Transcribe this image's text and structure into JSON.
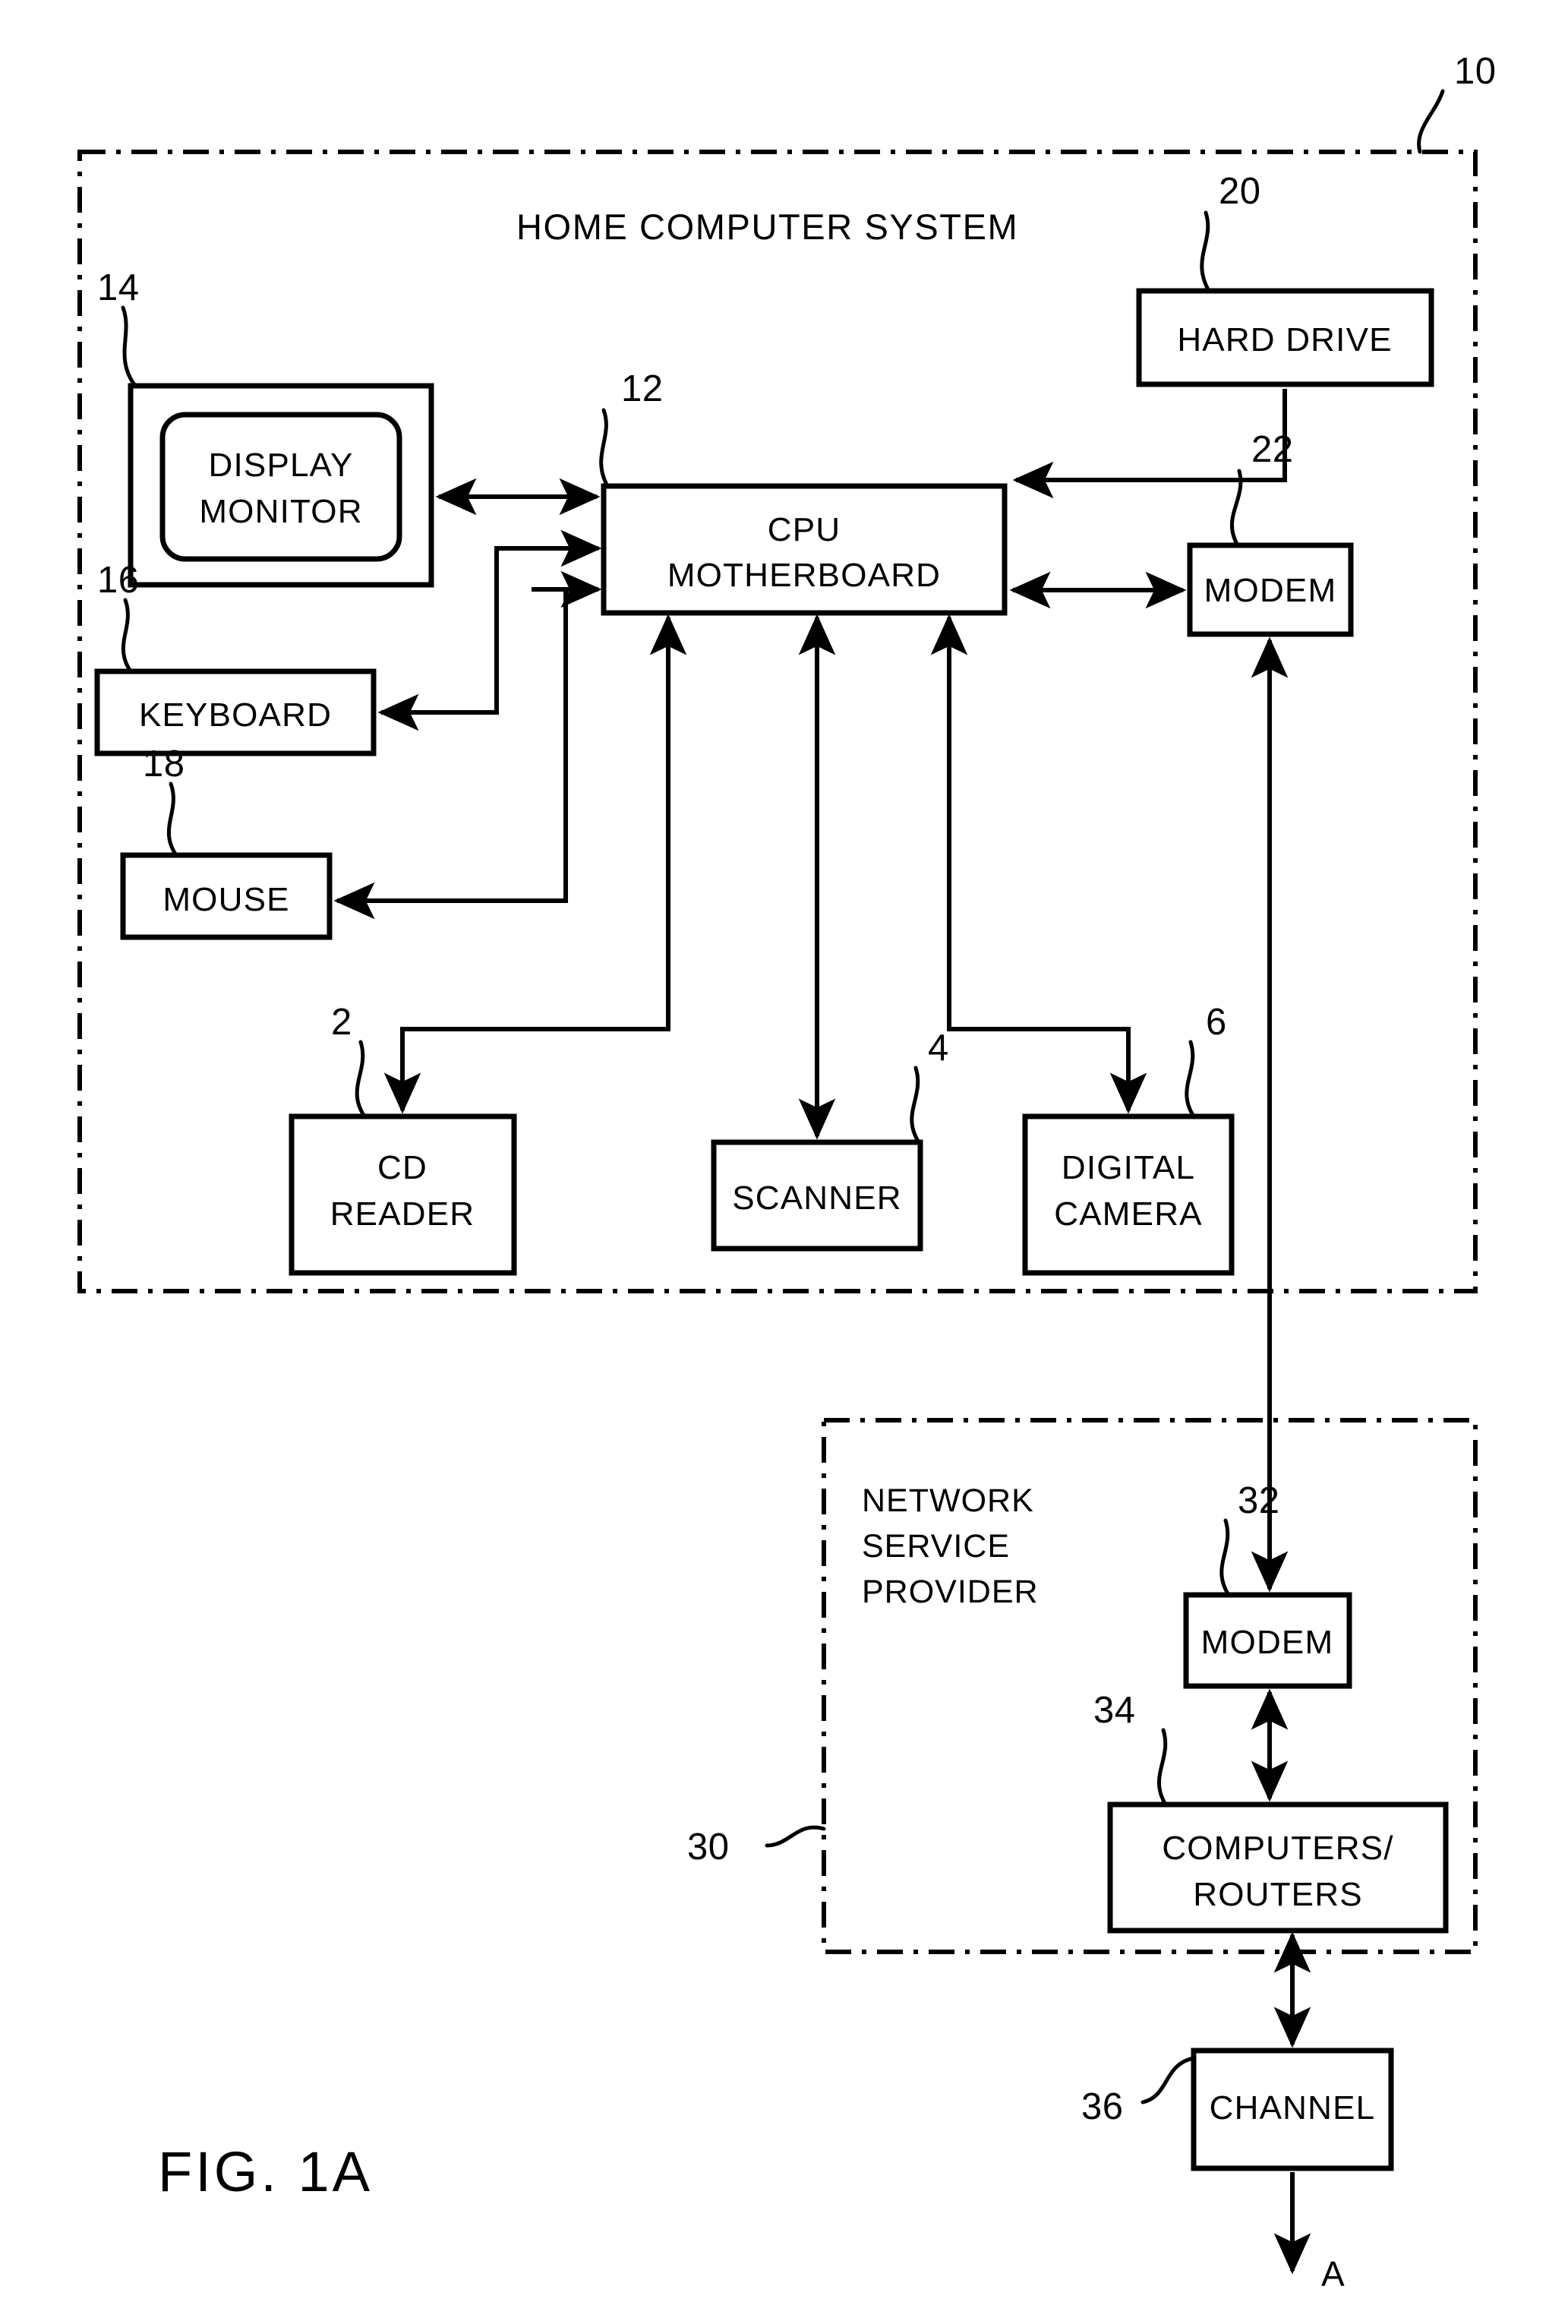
{
  "figure": {
    "caption": "FIG.  1A",
    "continuation_marker": "A"
  },
  "groups": [
    {
      "id": "home-computer-system",
      "title": "HOME COMPUTER SYSTEM",
      "ref": "10"
    },
    {
      "id": "network-service-provider",
      "title_lines": [
        "NETWORK",
        "SERVICE",
        "PROVIDER"
      ],
      "ref": "30"
    }
  ],
  "blocks": [
    {
      "id": "display-monitor",
      "ref": "14",
      "lines": [
        "DISPLAY",
        "MONITOR"
      ]
    },
    {
      "id": "cpu-motherboard",
      "ref": "12",
      "lines": [
        "CPU",
        "MOTHERBOARD"
      ]
    },
    {
      "id": "hard-drive",
      "ref": "20",
      "lines": [
        "HARD  DRIVE"
      ]
    },
    {
      "id": "modem-home",
      "ref": "22",
      "lines": [
        "MODEM"
      ]
    },
    {
      "id": "keyboard",
      "ref": "16",
      "lines": [
        "KEYBOARD"
      ]
    },
    {
      "id": "mouse",
      "ref": "18",
      "lines": [
        "MOUSE"
      ]
    },
    {
      "id": "cd-reader",
      "ref": "2",
      "lines": [
        "CD",
        "READER"
      ]
    },
    {
      "id": "scanner",
      "ref": "4",
      "lines": [
        "SCANNER"
      ]
    },
    {
      "id": "digital-camera",
      "ref": "6",
      "lines": [
        "DIGITAL",
        "CAMERA"
      ]
    },
    {
      "id": "modem-nsp",
      "ref": "32",
      "lines": [
        "MODEM"
      ]
    },
    {
      "id": "computers-routers",
      "ref": "34",
      "lines": [
        "COMPUTERS/",
        "ROUTERS"
      ]
    },
    {
      "id": "channel",
      "ref": "36",
      "lines": [
        "CHANNEL"
      ]
    }
  ],
  "text": {
    "home_title": "HOME COMPUTER SYSTEM",
    "nsp_l1": "NETWORK",
    "nsp_l2": "SERVICE",
    "nsp_l3": "PROVIDER",
    "display_l1": "DISPLAY",
    "display_l2": "MONITOR",
    "cpu_l1": "CPU",
    "cpu_l2": "MOTHERBOARD",
    "hard_drive": "HARD  DRIVE",
    "modem_home": "MODEM",
    "keyboard": "KEYBOARD",
    "mouse": "MOUSE",
    "cd_l1": "CD",
    "cd_l2": "READER",
    "scanner": "SCANNER",
    "cam_l1": "DIGITAL",
    "cam_l2": "CAMERA",
    "modem_nsp": "MODEM",
    "cr_l1": "COMPUTERS/",
    "cr_l2": "ROUTERS",
    "channel": "CHANNEL",
    "fig_caption": "FIG.  1A",
    "marker_a": "A"
  },
  "refs": {
    "n10": "10",
    "n12": "12",
    "n14": "14",
    "n16": "16",
    "n18": "18",
    "n20": "20",
    "n22": "22",
    "n2": "2",
    "n4": "4",
    "n6": "6",
    "n30": "30",
    "n32": "32",
    "n34": "34",
    "n36": "36"
  },
  "colors": {
    "ink": "#000000",
    "paper": "#ffffff"
  }
}
